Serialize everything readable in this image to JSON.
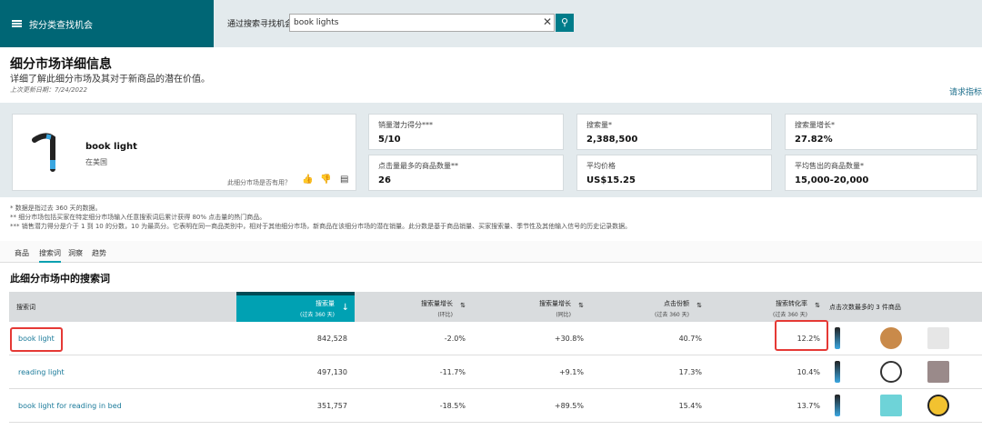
{
  "header": {
    "category_nav": "按分类查找机会",
    "search_label": "通过搜索寻找机会",
    "search_value": "book lights"
  },
  "page": {
    "title": "细分市场详细信息",
    "subtitle": "详细了解此细分市场及其对于新商品的潜在价值。",
    "updated": "上次更新日期：7/24/2022",
    "request_link": "请求指标"
  },
  "product": {
    "name": "book light",
    "location": "在美国",
    "useful_prompt": "此细分市场是否有用？"
  },
  "metrics": [
    {
      "label": "销量潜力得分***",
      "value": "5/10"
    },
    {
      "label": "搜索量*",
      "value": "2,388,500"
    },
    {
      "label": "搜索量增长*",
      "value": "27.82%"
    },
    {
      "label": "点击量最多的商品数量**",
      "value": "26"
    },
    {
      "label": "平均价格",
      "value": "US$15.25"
    },
    {
      "label": "平均售出的商品数量*",
      "value": "15,000-20,000"
    }
  ],
  "notes": [
    "* 数据是指过去 360 天的数据。",
    "** 细分市场包括买家在特定细分市场输入任意搜索词后累计获得 80% 点击量的热门商品。",
    "*** 销售潜力得分是介于 1 到 10 的分数，10 为最高分。它表明在同一商品类别中，相对于其他细分市场，新商品在该细分市场的潜在销量。此分数是基于商品销量、买家搜索量、季节性及其他输入信号的历史记录数据。"
  ],
  "tabs": [
    "商品",
    "搜索词",
    "洞察",
    "趋势"
  ],
  "section_title": "此细分市场中的搜索词",
  "table": {
    "headers": [
      {
        "t": "搜索词",
        "s": ""
      },
      {
        "t": "搜索量",
        "s": "(过去 360 天)"
      },
      {
        "t": "搜索量增长",
        "s": "(环比)"
      },
      {
        "t": "搜索量增长",
        "s": "(同比)"
      },
      {
        "t": "点击份额",
        "s": "(过去 360 天)"
      },
      {
        "t": "搜索转化率",
        "s": "(过去 360 天)"
      },
      {
        "t": "点击次数最多的 3 件商品",
        "s": ""
      }
    ],
    "rows": [
      [
        "book light",
        "842,528",
        "-2.0%",
        "+30.8%",
        "40.7%",
        "12.2%"
      ],
      [
        "reading light",
        "497,130",
        "-11.7%",
        "+9.1%",
        "17.3%",
        "10.4%"
      ],
      [
        "book light for reading in bed",
        "351,757",
        "-18.5%",
        "+89.5%",
        "15.4%",
        "13.7%"
      ]
    ]
  }
}
